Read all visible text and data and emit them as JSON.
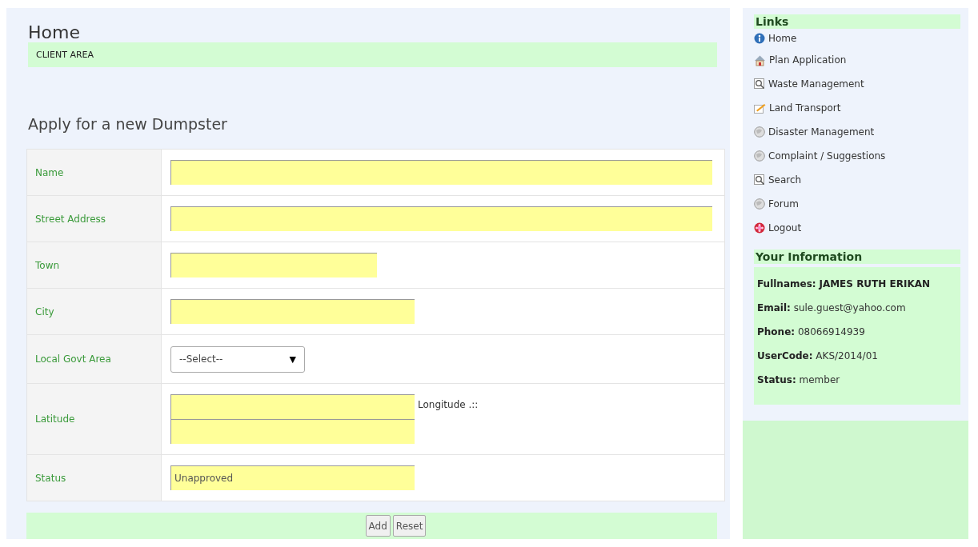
{
  "page_title": "Home",
  "banner": "CLIENT AREA",
  "form": {
    "title": "Apply for a new Dumpster",
    "rows": [
      {
        "label": "Name",
        "kind": "long"
      },
      {
        "label": "Street Address",
        "kind": "long"
      },
      {
        "label": "Town",
        "kind": "short"
      },
      {
        "label": "City",
        "kind": "medium"
      },
      {
        "label": "Local Govt Area",
        "kind": "select",
        "value": "--Select--",
        "arrow": "▼"
      },
      {
        "label": "Latitude",
        "kind": "pair",
        "side_label": "Longitude .::"
      },
      {
        "label": "Status",
        "kind": "medium",
        "value": "Unapproved"
      }
    ],
    "buttons": [
      "Add",
      "Reset"
    ]
  },
  "sidebar": {
    "links_title": "Links",
    "links": [
      {
        "label": "Home",
        "kind": "info"
      },
      {
        "label": "Plan Application",
        "kind": "house"
      },
      {
        "label": "Waste Management",
        "kind": "search"
      },
      {
        "label": "Land Transport",
        "kind": "edit"
      },
      {
        "label": "Disaster Management",
        "kind": "globe"
      },
      {
        "label": "Complaint / Suggestions",
        "kind": "globe"
      },
      {
        "label": "Search",
        "kind": "search"
      },
      {
        "label": "Forum",
        "kind": "globe"
      },
      {
        "label": "Logout",
        "kind": "logout"
      }
    ],
    "info_title": "Your Information",
    "info": [
      {
        "key": "Fullnames:",
        "value": "JAMES RUTH ERIKAN",
        "kind": "bold"
      },
      {
        "key": "Email:",
        "value": "sule.guest@yahoo.com",
        "kind": "plain"
      },
      {
        "key": "Phone:",
        "value": "08066914939",
        "kind": "plain"
      },
      {
        "key": "UserCode:",
        "value": "AKS/2014/01",
        "kind": "plain"
      },
      {
        "key": "Status:",
        "value": "member",
        "kind": "plain"
      }
    ]
  }
}
